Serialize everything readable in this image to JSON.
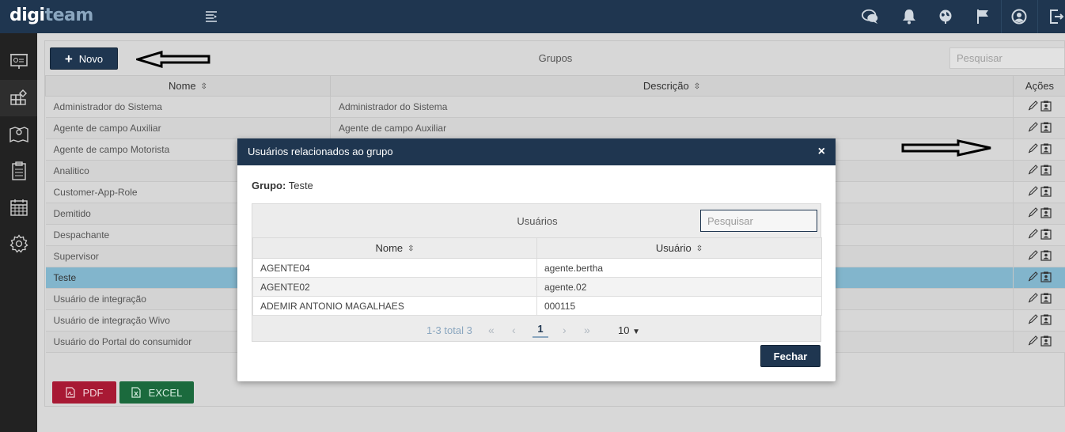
{
  "app": {
    "logo_left": "digi",
    "logo_right": "team"
  },
  "topbar": {
    "icons": [
      "menu-toggle-icon",
      "chat-icon",
      "bell-icon",
      "globe-icon",
      "flag-icon",
      "user-icon",
      "logout-icon"
    ]
  },
  "sidebar": {
    "items": [
      "dashboard-icon",
      "modules-icon",
      "map-icon",
      "clipboard-icon",
      "calendar-icon",
      "settings-icon"
    ]
  },
  "main": {
    "new_button": "Novo",
    "title": "Grupos",
    "search_placeholder": "Pesquisar",
    "columns": {
      "name": "Nome",
      "description": "Descrição",
      "actions": "Ações"
    },
    "rows": [
      {
        "name": "Administrador do Sistema",
        "description": "Administrador do Sistema"
      },
      {
        "name": "Agente de campo Auxiliar",
        "description": "Agente de campo Auxiliar"
      },
      {
        "name": "Agente de campo Motorista",
        "description": ""
      },
      {
        "name": "Analitico",
        "description": ""
      },
      {
        "name": "Customer-App-Role",
        "description": ""
      },
      {
        "name": "Demitido",
        "description": ""
      },
      {
        "name": "Despachante",
        "description": ""
      },
      {
        "name": "Supervisor",
        "description": ""
      },
      {
        "name": "Teste",
        "description": ""
      },
      {
        "name": "Usuário de integração",
        "description": ""
      },
      {
        "name": "Usuário de integração Wivo",
        "description": ""
      },
      {
        "name": "Usuário do Portal do consumidor",
        "description": ""
      }
    ],
    "selected_row": 8,
    "pdf_button": "PDF",
    "excel_button": "EXCEL"
  },
  "modal": {
    "title": "Usuários relacionados ao grupo",
    "close": "×",
    "group_label": "Grupo:",
    "group_value": "Teste",
    "table_title": "Usuários",
    "search_placeholder": "Pesquisar",
    "columns": {
      "name": "Nome",
      "user": "Usuário"
    },
    "rows": [
      {
        "name": "AGENTE04",
        "user": "agente.bertha"
      },
      {
        "name": "AGENTE02",
        "user": "agente.02"
      },
      {
        "name": "ADEMIR ANTONIO MAGALHAES",
        "user": "000115"
      }
    ],
    "pager": {
      "info": "1-3 total 3",
      "first": "«",
      "prev": "‹",
      "current": "1",
      "next": "›",
      "last": "»",
      "page_size": "10"
    },
    "close_button": "Fechar"
  }
}
